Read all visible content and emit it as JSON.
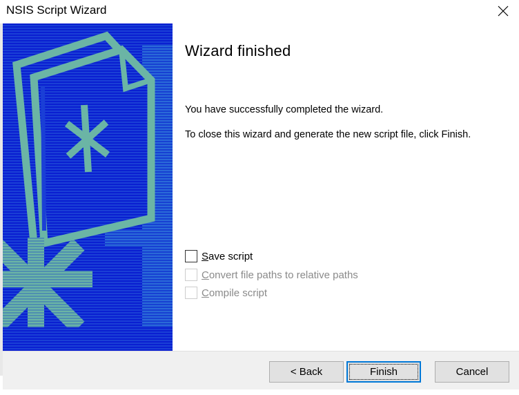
{
  "window": {
    "title": "NSIS Script Wizard"
  },
  "page": {
    "heading": "Wizard finished",
    "line1": "You have successfully completed the wizard.",
    "line2": "To close this wizard and generate the new script file, click Finish."
  },
  "options": [
    {
      "accel": "S",
      "rest": "ave script",
      "checked": false,
      "enabled": true
    },
    {
      "accel": "C",
      "rest": "onvert file paths to relative paths",
      "checked": false,
      "enabled": false
    },
    {
      "accel": "C",
      "rest": "ompile script",
      "checked": false,
      "enabled": false
    }
  ],
  "buttons": {
    "back": "< Back",
    "finish": "Finish",
    "cancel": "Cancel"
  },
  "colors": {
    "banner_blue": "#0a1fd1",
    "banner_stripe": "#1e58d8",
    "banner_art": "#6bb5a5",
    "focus_border": "#0078d7"
  },
  "icons": {
    "close": "close-icon",
    "banner": "wizard-banner-image"
  }
}
